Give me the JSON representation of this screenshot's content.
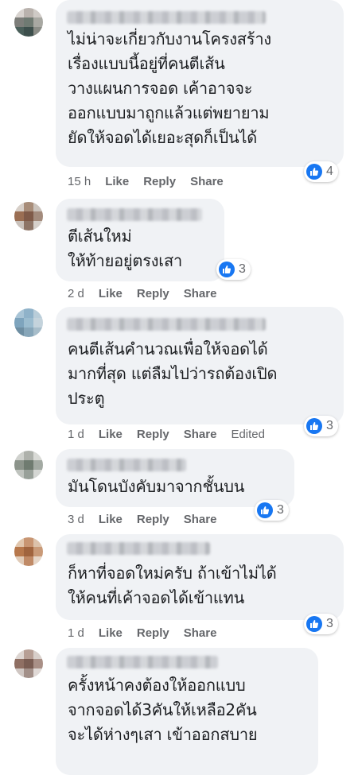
{
  "comments": [
    {
      "lines": "ไม่น่าจะเกี่ยวกับงานโครงสร้าง\nเรื่องแบบนี้อยู่ที่คนตีเส้น\nวางแผนการจอด เค้าอาจจะ\nออกแบบมาถูกแล้วแต่พยายาม\nยัดให้จอดได้เยอะสุดก็เป็นได้",
      "time": "15 h",
      "like": "Like",
      "reply": "Reply",
      "share": "Share",
      "edited": "",
      "reactions": "4"
    },
    {
      "lines": "ตีเส้นใหม่\nให้ท้ายอยู่ตรงเสา",
      "time": "2 d",
      "like": "Like",
      "reply": "Reply",
      "share": "Share",
      "edited": "",
      "reactions": "3"
    },
    {
      "lines": "คนตีเส้นคำนวณเพื่อให้จอดได้\nมากที่สุด แต่ลืมไปว่ารถต้องเปิด\nประตู",
      "time": "1 d",
      "like": "Like",
      "reply": "Reply",
      "share": "Share",
      "edited": "Edited",
      "reactions": "3"
    },
    {
      "lines": "มันโดนบังคับมาจากชั้นบน",
      "time": "3 d",
      "like": "Like",
      "reply": "Reply",
      "share": "Share",
      "edited": "",
      "reactions": "3"
    },
    {
      "lines": "ก็หาที่จอดใหม่ครับ ถ้าเข้าไม่ได้\nให้คนที่เค้าจอดได้เข้าแทน",
      "time": "1 d",
      "like": "Like",
      "reply": "Reply",
      "share": "Share",
      "edited": "",
      "reactions": "3"
    },
    {
      "lines": "ครั้งหน้าคงต้องให้ออกแบบ\nจากจอดได้3คันให้เหลือ2คัน\nจะได้ห่างๆเสา เข้าออกสบาย",
      "time": "",
      "like": "",
      "reply": "",
      "share": "",
      "edited": "",
      "reactions": ""
    }
  ],
  "colors": {
    "bubble": "#f0f2f5",
    "like_blue": "#1877f2",
    "meta": "#65676b",
    "text": "#1c1e21"
  },
  "icons": {
    "reaction": "thumbs-up-icon"
  }
}
